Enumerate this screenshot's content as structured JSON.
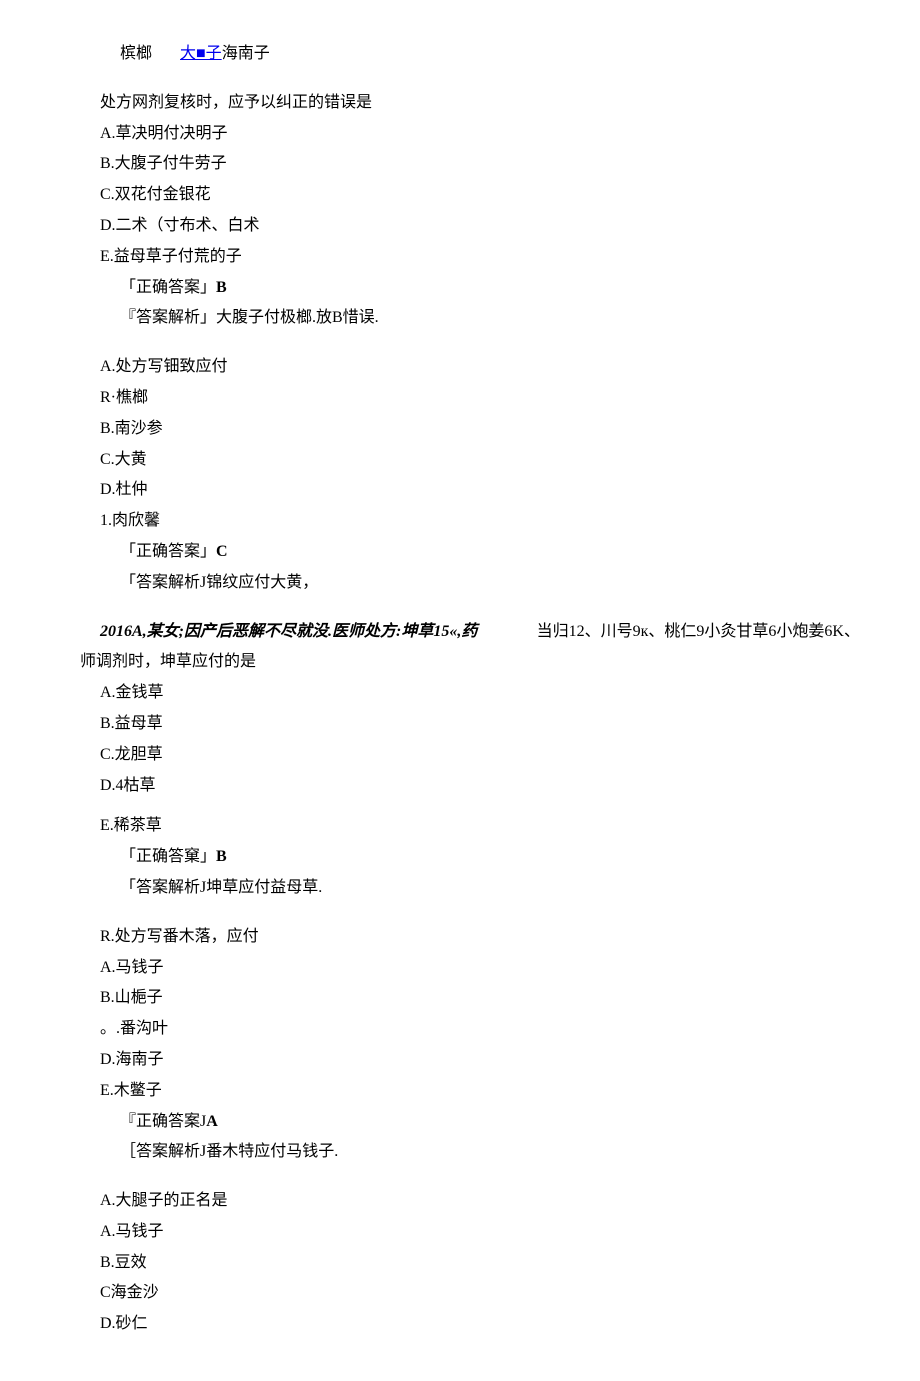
{
  "header": {
    "text1": "槟榔",
    "link": "大■子",
    "text2": "海南子"
  },
  "q1": {
    "stem": "处方网剂复核时，应予以纠正的错误是",
    "optA": "A.草决明付决明子",
    "optB": "B.大腹子付牛劳子",
    "optC": "C.双花付金银花",
    "optD": "D.二术（寸布术、白术",
    "optE": "E.益母草子付荒的子",
    "ans_label": "「正确答案」",
    "ans": "B",
    "exp": "『答案解析」大腹子付极榔.放B惜误."
  },
  "q2": {
    "stem": "A.处方写钿致应付",
    "optR": "R·樵榔",
    "optB": "B.南沙参",
    "optC": "C.大黄",
    "optD": "D.杜仲",
    "opt1": "1.肉欣馨",
    "ans_label": "「正确答案」",
    "ans": "C",
    "exp": "「答案解析J锦纹应付大黄，"
  },
  "q3": {
    "stem_left": "2016A,某女;因产后恶解不尽就没.医师处方:坤草15«,药",
    "stem_right": "当归12、川号9к、桃仁9小灸甘草6小炮姜6K、",
    "stem2": "师调剂时，坤草应付的是",
    "optA": "A.金钱草",
    "optB": "B.益母草",
    "optC": "C.龙胆草",
    "optD": "D.4枯草",
    "optE": "E.稀茶草",
    "ans_label": "「正确答窠」",
    "ans": "B",
    "exp": "「答案解析J坤草应付益母草."
  },
  "q4": {
    "stem": "R.处方写番木落，应付",
    "optA": "A.马钱子",
    "optB": "B.山梔子",
    "optC": "。.番沟叶",
    "optD": "D.海南子",
    "optE": "E.木鳖子",
    "ans_label": "『正确答案J",
    "ans": "A",
    "exp": "［答案解析J番木特应付马钱子."
  },
  "q5": {
    "stem": "A.大腿子的正名是",
    "optA": "A.马钱子",
    "optB": "B.豆效",
    "optC": "C海金沙",
    "optD": "D.砂仁"
  }
}
